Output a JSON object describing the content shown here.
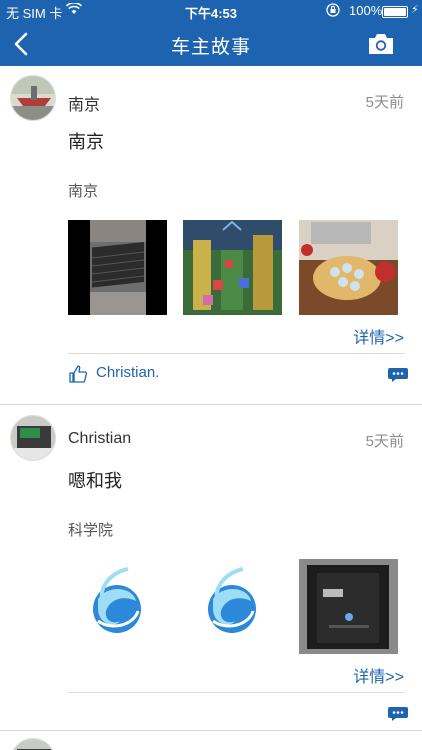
{
  "status_bar": {
    "carrier": "无 SIM 卡",
    "time": "下午4:53",
    "battery": "100%",
    "battery_level": 1.0
  },
  "navbar": {
    "title": "车主故事",
    "back_icon": "chevron-left-icon",
    "camera_icon": "camera-icon"
  },
  "posts": [
    {
      "author": "南京",
      "date": "5天前",
      "title": "南京",
      "label": "南京",
      "photos": [
        "keyboard-photo",
        "toy-blocks-photo",
        "food-platter-photo"
      ],
      "more": "详情>>",
      "liker": "Christian."
    },
    {
      "author": "Christian",
      "date": "5天前",
      "title": "嗯和我",
      "label": "科学院",
      "photos": [
        "app-logo-image",
        "app-logo-image",
        "phone-screen-photo"
      ],
      "more": "详情>>"
    }
  ],
  "colors": {
    "header": "#1e63b0",
    "link": "#1e63b0",
    "date": "#8e8e8e"
  }
}
